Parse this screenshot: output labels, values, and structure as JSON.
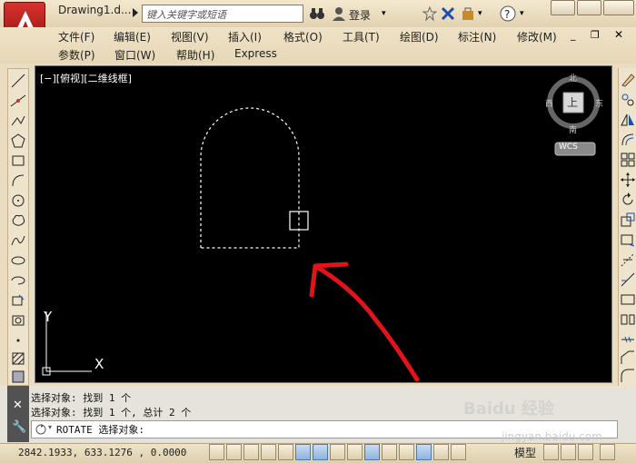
{
  "title_bar": {
    "doc_title": "Drawing1.d...",
    "search_placeholder": "键入关键字或短语",
    "login_label": "登录"
  },
  "menu": {
    "row1": [
      "文件(F)",
      "编辑(E)",
      "视图(V)",
      "插入(I)",
      "格式(O)",
      "工具(T)",
      "绘图(D)",
      "标注(N)",
      "修改(M)"
    ],
    "row2": [
      "参数(P)",
      "窗口(W)",
      "帮助(H)",
      "Express"
    ]
  },
  "viewport": {
    "label": "[−][俯视][二维线框]"
  },
  "viewcube": {
    "north": "北",
    "south": "南",
    "east": "东",
    "west": "西",
    "face": "上",
    "wcs": "WCS"
  },
  "ucs": {
    "x_label": "X",
    "y_label": "Y"
  },
  "command": {
    "history": [
      "选择对象: 找到 1 个",
      "选择对象: 找到 1 个, 总计 2 个"
    ],
    "prompt": "ROTATE 选择对象:"
  },
  "status": {
    "coords": "2842.1933, 633.1276 , 0.0000",
    "model_label": "模型"
  },
  "watermark": {
    "main": "Baidu 经验",
    "sub": "jingyan.baidu.com"
  },
  "colors": {
    "annotation_arrow": "#e0141a",
    "canvas_bg": "#000000",
    "selection": "#ffffff"
  }
}
